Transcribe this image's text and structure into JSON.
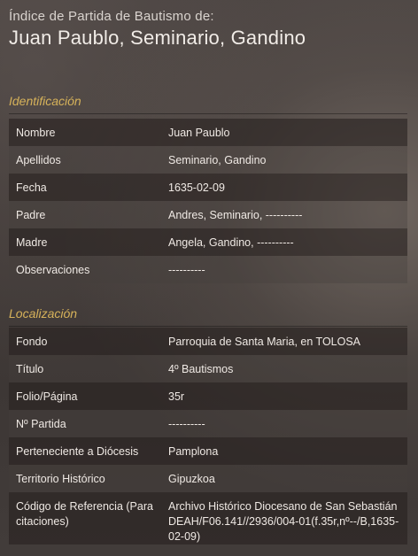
{
  "header": {
    "subtitle": "Índice de Partida de Bautismo de:",
    "title": "Juan Paublo, Seminario, Gandino"
  },
  "sections": {
    "identificacion": {
      "heading": "Identificación",
      "rows": [
        {
          "label": "Nombre",
          "value": "Juan Paublo"
        },
        {
          "label": "Apellidos",
          "value": "Seminario, Gandino"
        },
        {
          "label": "Fecha",
          "value": "1635-02-09"
        },
        {
          "label": "Padre",
          "value": "Andres, Seminario, ----------"
        },
        {
          "label": "Madre",
          "value": "Angela, Gandino, ----------"
        },
        {
          "label": "Observaciones",
          "value": "----------"
        }
      ]
    },
    "localizacion": {
      "heading": "Localización",
      "rows": [
        {
          "label": "Fondo",
          "value": "Parroquia de Santa Maria, en TOLOSA"
        },
        {
          "label": "Título",
          "value": "4º Bautismos"
        },
        {
          "label": "Folio/Página",
          "value": "35r"
        },
        {
          "label": "Nº Partida",
          "value": "----------"
        },
        {
          "label": "Perteneciente a Diócesis",
          "value": "Pamplona"
        },
        {
          "label": "Territorio Histórico",
          "value": "Gipuzkoa"
        },
        {
          "label": "Código de Referencia (Para citaciones)",
          "value": "Archivo Histórico Diocesano de San Sebastián DEAH/F06.141//2936/004-01(f.35r,nº--/B,1635-02-09)"
        }
      ]
    }
  }
}
